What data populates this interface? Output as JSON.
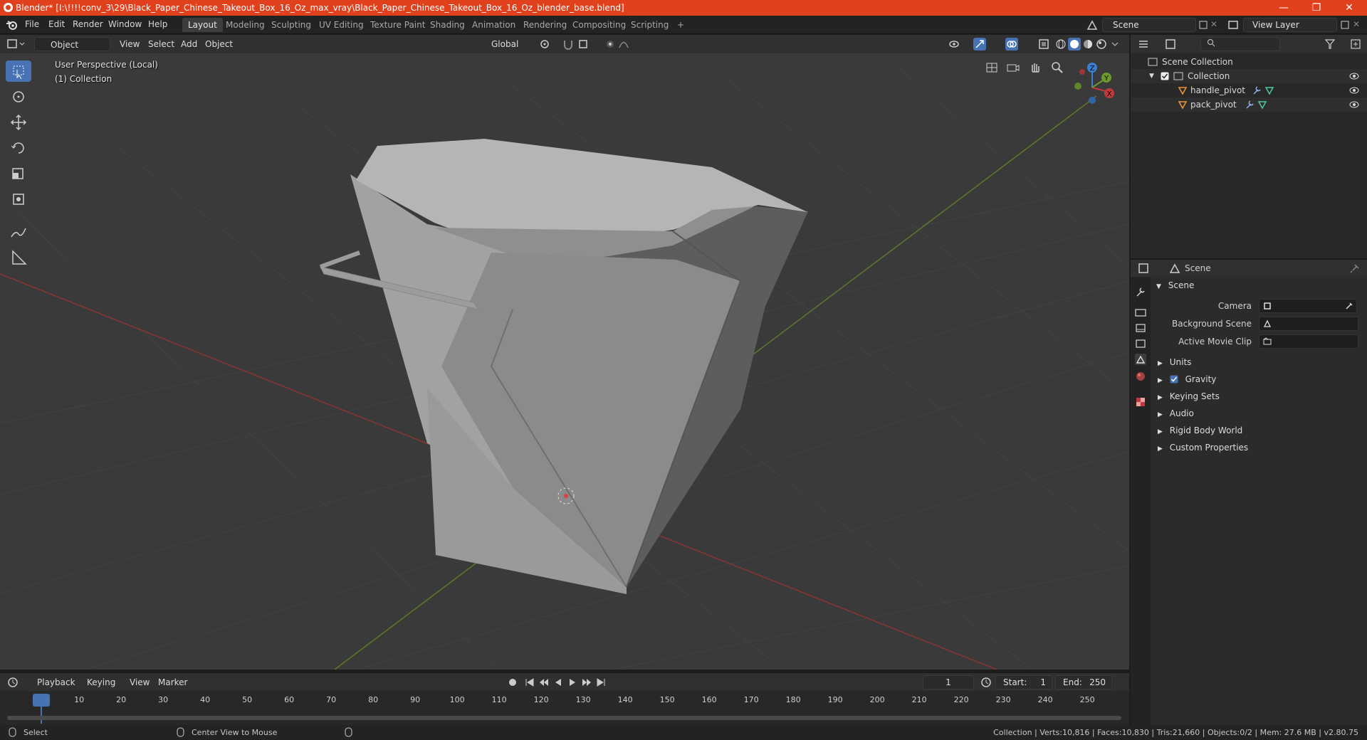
{
  "window": {
    "title": "Blender* [I:\\!!!!conv_3\\29\\Black_Paper_Chinese_Takeout_Box_16_Oz_max_vray\\Black_Paper_Chinese_Takeout_Box_16_Oz_blender_base.blend]",
    "minimize": "—",
    "restore": "❐",
    "close": "✕"
  },
  "menu": [
    "File",
    "Edit",
    "Render",
    "Window",
    "Help"
  ],
  "workspaces": [
    "Layout",
    "Modeling",
    "Sculpting",
    "UV Editing",
    "Texture Paint",
    "Shading",
    "Animation",
    "Rendering",
    "Compositing",
    "Scripting",
    "+"
  ],
  "active_workspace": "Layout",
  "scene_selector": "Scene",
  "view_layer_selector": "View Layer",
  "viewport_header": {
    "mode": "Object Mode",
    "menus": [
      "View",
      "Select",
      "Add",
      "Object"
    ],
    "orientation": "Global"
  },
  "viewport": {
    "perspective": "User Perspective (Local)",
    "collection": "(1) Collection",
    "gizmo_axes": [
      "X",
      "Y",
      "Z"
    ]
  },
  "outliner": {
    "root": "Scene Collection",
    "items": [
      {
        "name": "Collection",
        "level": 1
      },
      {
        "name": "handle_pivot",
        "level": 2
      },
      {
        "name": "pack_pivot",
        "level": 2
      }
    ]
  },
  "properties": {
    "header": "Scene",
    "panel": "Scene",
    "fields": [
      {
        "label": "Camera"
      },
      {
        "label": "Background Scene"
      },
      {
        "label": "Active Movie Clip"
      }
    ],
    "subpanels": [
      "Units",
      "Gravity",
      "Keying Sets",
      "Audio",
      "Rigid Body World",
      "Custom Properties"
    ],
    "gravity_checked": true
  },
  "timeline": {
    "menus": [
      "Playback",
      "Keying",
      "View",
      "Marker"
    ],
    "current_frame": "1",
    "start_label": "Start:",
    "start": "1",
    "end_label": "End:",
    "end": "250",
    "ticks": [
      "1",
      "10",
      "20",
      "30",
      "40",
      "50",
      "60",
      "70",
      "80",
      "90",
      "100",
      "110",
      "120",
      "130",
      "140",
      "150",
      "160",
      "170",
      "180",
      "190",
      "200",
      "210",
      "220",
      "230",
      "240",
      "250"
    ]
  },
  "statusbar": {
    "left1": "Select",
    "left2": "Center View to Mouse",
    "right": "Collection | Verts:10,816 | Faces:10,830 | Tris:21,660 | Objects:0/2 | Mem: 27.6 MB | v2.80.75"
  },
  "colors": {
    "titlebar": "#e0401c",
    "accent": "#4772b3",
    "x_axis": "#c2393d",
    "y_axis": "#6c9a2b",
    "z_axis": "#3b7fd4"
  }
}
